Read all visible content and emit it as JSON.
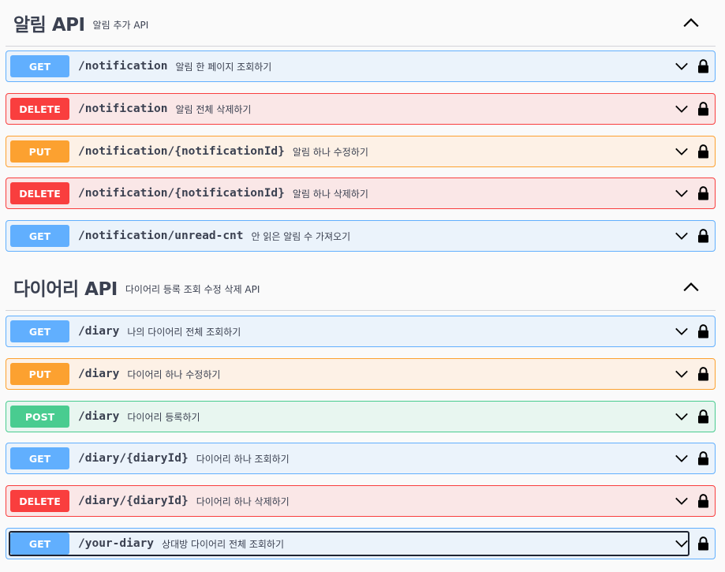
{
  "sections": [
    {
      "title": "알림 API",
      "description": "알림 추가 API",
      "operations": [
        {
          "method": "GET",
          "path": "/notification",
          "summary": "알림 한 페이지 조회하기"
        },
        {
          "method": "DELETE",
          "path": "/notification",
          "summary": "알림 전체 삭제하기"
        },
        {
          "method": "PUT",
          "path": "/notification/{notificationId}",
          "summary": "알림 하나 수정하기"
        },
        {
          "method": "DELETE",
          "path": "/notification/{notificationId}",
          "summary": "알림 하나 삭제하기"
        },
        {
          "method": "GET",
          "path": "/notification/unread-cnt",
          "summary": "안 읽은 알림 수 가져오기"
        }
      ]
    },
    {
      "title": "다이어리 API",
      "description": "다이어리 등록 조회 수정 삭제 API",
      "operations": [
        {
          "method": "GET",
          "path": "/diary",
          "summary": "나의 다이어리 전체 조회하기"
        },
        {
          "method": "PUT",
          "path": "/diary",
          "summary": "다이어리 하나 수정하기"
        },
        {
          "method": "POST",
          "path": "/diary",
          "summary": "다이어리 등록하기"
        },
        {
          "method": "GET",
          "path": "/diary/{diaryId}",
          "summary": "다이어리 하나 조회하기"
        },
        {
          "method": "DELETE",
          "path": "/diary/{diaryId}",
          "summary": "다이어리 하나 삭제하기"
        },
        {
          "method": "GET",
          "path": "/your-diary",
          "summary": "상대방 다이어리 전체 조회하기"
        }
      ]
    }
  ],
  "colors": {
    "get": "#61affe",
    "delete": "#f93e3e",
    "put": "#fca130",
    "post": "#49cc90",
    "text": "#3b4151"
  },
  "icons": {
    "collapse": "chevron-up-icon",
    "expand": "chevron-down-icon",
    "auth": "lock-icon"
  }
}
